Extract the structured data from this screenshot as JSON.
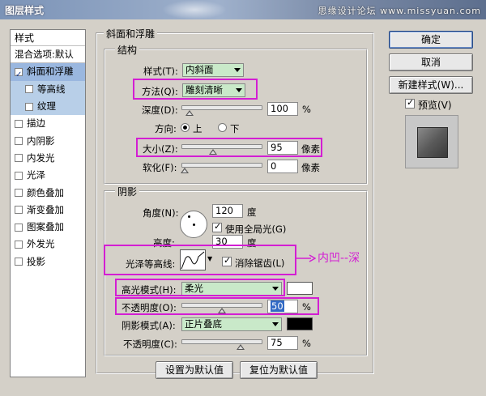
{
  "window": {
    "title": "图层样式",
    "watermark": "思缘设计论坛 www.missyuan.com"
  },
  "style_list": {
    "header": "样式",
    "blend_options": "混合选项:默认",
    "items": [
      {
        "label": "斜面和浮雕",
        "checked": true
      },
      {
        "label": "等高线",
        "checked": false
      },
      {
        "label": "纹理",
        "checked": false
      },
      {
        "label": "描边",
        "checked": false
      },
      {
        "label": "内阴影",
        "checked": false
      },
      {
        "label": "内发光",
        "checked": false
      },
      {
        "label": "光泽",
        "checked": false
      },
      {
        "label": "颜色叠加",
        "checked": false
      },
      {
        "label": "渐变叠加",
        "checked": false
      },
      {
        "label": "图案叠加",
        "checked": false
      },
      {
        "label": "外发光",
        "checked": false
      },
      {
        "label": "投影",
        "checked": false
      }
    ]
  },
  "bevel": {
    "group_title": "斜面和浮雕",
    "structure": {
      "title": "结构",
      "style_label": "样式(T):",
      "style_value": "内斜面",
      "technique_label": "方法(Q):",
      "technique_value": "雕刻清晰",
      "depth_label": "深度(D):",
      "depth_value": "100",
      "depth_unit": "%",
      "direction_label": "方向:",
      "direction_up": "上",
      "direction_down": "下",
      "size_label": "大小(Z):",
      "size_value": "95",
      "size_unit": "像素",
      "soften_label": "软化(F):",
      "soften_value": "0",
      "soften_unit": "像素"
    },
    "shading": {
      "title": "阴影",
      "angle_label": "角度(N):",
      "angle_value": "120",
      "angle_unit": "度",
      "global_light_label": "使用全局光(G)",
      "altitude_label": "高度:",
      "altitude_value": "30",
      "altitude_unit": "度",
      "gloss_label": "光泽等高线:",
      "antialias_label": "消除锯齿(L)",
      "annotation": "内凹--深",
      "highlight_mode_label": "高光模式(H):",
      "highlight_mode_value": "柔光",
      "highlight_opacity_label": "不透明度(O):",
      "highlight_opacity_value": "50",
      "highlight_opacity_unit": "%",
      "shadow_mode_label": "阴影模式(A):",
      "shadow_mode_value": "正片叠底",
      "shadow_opacity_label": "不透明度(C):",
      "shadow_opacity_value": "75",
      "shadow_opacity_unit": "%"
    },
    "make_default": "设置为默认值",
    "reset_default": "复位为默认值"
  },
  "buttons": {
    "ok": "确定",
    "cancel": "取消",
    "new_style": "新建样式(W)...",
    "preview_label": "预览(V)"
  },
  "sliders": {
    "depth": 0.06,
    "size": 0.38,
    "soften": 0.0,
    "highlight_opacity": 0.5,
    "shadow_opacity": 0.75
  },
  "colors": {
    "highlight_swatch": "#ffffff",
    "shadow_swatch": "#000000",
    "annotation": "#d31ed3"
  }
}
